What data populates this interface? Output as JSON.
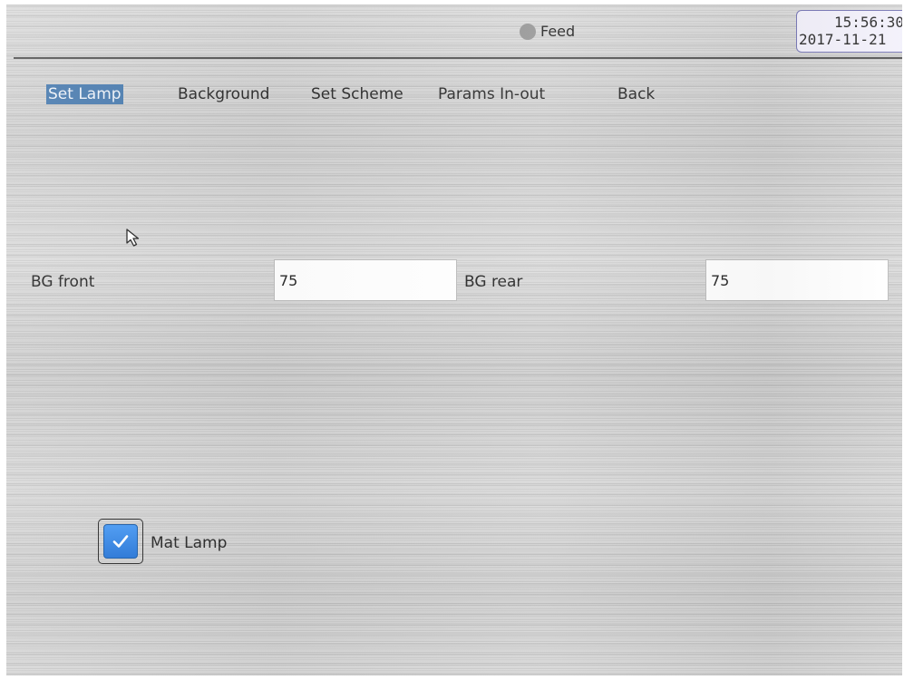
{
  "header": {
    "status_label": "Feed",
    "status_color": "#9a9a9a",
    "time": "15:56:30",
    "date": "2017-11-21"
  },
  "nav": {
    "items": [
      {
        "label": "Set Lamp",
        "active": true
      },
      {
        "label": "Background",
        "active": false
      },
      {
        "label": "Set Scheme",
        "active": false
      },
      {
        "label": "Params In-out",
        "active": false
      },
      {
        "label": "Back",
        "active": false
      }
    ],
    "active_color": "#4f7fb1"
  },
  "fields": {
    "bg_front": {
      "label": "BG front",
      "value": "75"
    },
    "bg_rear": {
      "label": "BG rear",
      "value": "75"
    }
  },
  "checkbox": {
    "label": "Mat Lamp",
    "checked": true,
    "color": "#2f80e0"
  },
  "cursor": {
    "icon": "arrow-pointer-icon"
  }
}
